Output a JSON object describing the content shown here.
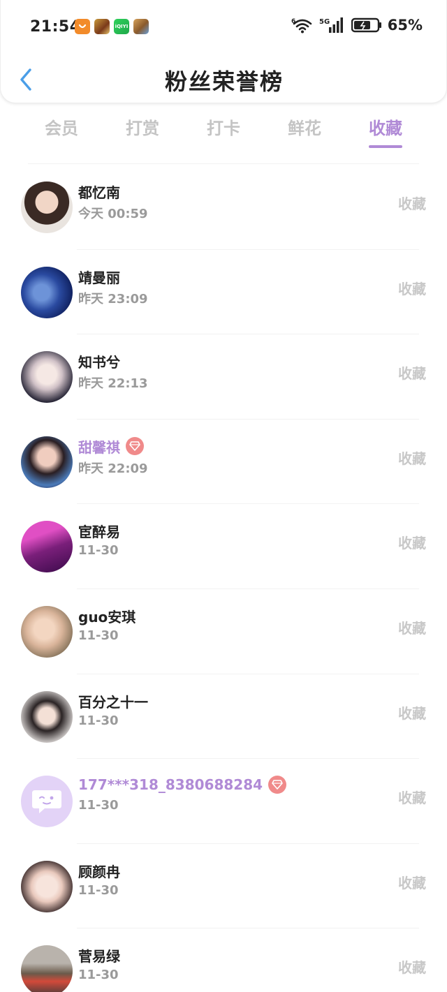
{
  "status_bar": {
    "time": "21:54",
    "battery": "65%",
    "iqiyi_label": "iQIYI",
    "signal_label": "5G",
    "wifi_label": "6"
  },
  "nav": {
    "title": "粉丝荣誉榜"
  },
  "tabs": [
    {
      "label": "会员",
      "active": false
    },
    {
      "label": "打赏",
      "active": false
    },
    {
      "label": "打卡",
      "active": false
    },
    {
      "label": "鲜花",
      "active": false
    },
    {
      "label": "收藏",
      "active": true
    }
  ],
  "rows": [
    {
      "name": "都忆南",
      "time": "今天 00:59",
      "action": "收藏",
      "vip": false
    },
    {
      "name": "靖曼丽",
      "time": "昨天 23:09",
      "action": "收藏",
      "vip": false
    },
    {
      "name": "知书兮",
      "time": "昨天 22:13",
      "action": "收藏",
      "vip": false
    },
    {
      "name": "甜馨祺",
      "time": "昨天 22:09",
      "action": "收藏",
      "vip": true
    },
    {
      "name": "宦醉易",
      "time": "11-30",
      "action": "收藏",
      "vip": false
    },
    {
      "name": "guo安琪",
      "time": "11-30",
      "action": "收藏",
      "vip": false
    },
    {
      "name": "百分之十一",
      "time": "11-30",
      "action": "收藏",
      "vip": false
    },
    {
      "name": "177***318_8380688284",
      "time": "11-30",
      "action": "收藏",
      "vip": true
    },
    {
      "name": "顾颜冉",
      "time": "11-30",
      "action": "收藏",
      "vip": false
    },
    {
      "name": "菅易绿",
      "time": "11-30",
      "action": "收藏",
      "vip": false
    }
  ],
  "colors": {
    "accent": "#b08ad6",
    "vip_badge": "#f08a8a",
    "muted": "#c8c8c8"
  }
}
